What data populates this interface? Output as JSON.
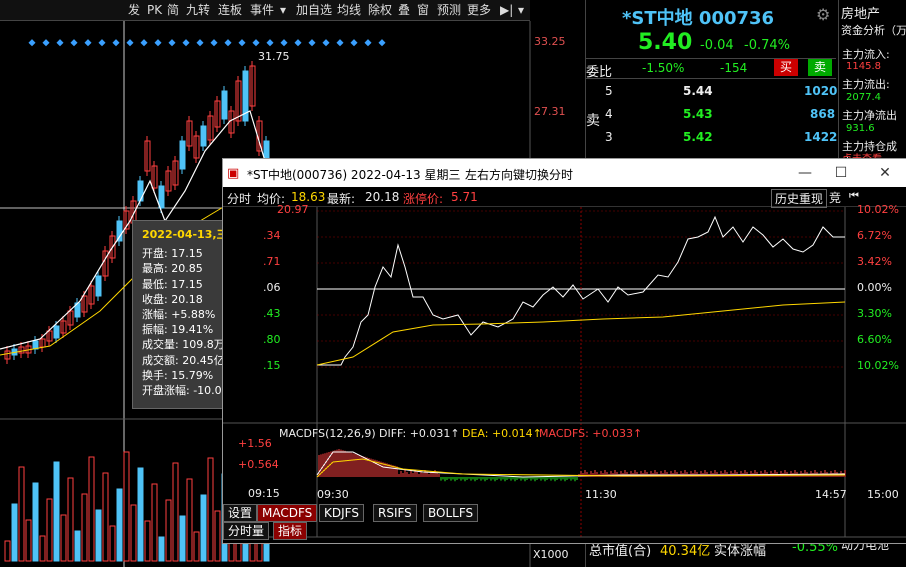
{
  "toolbar": {
    "items": [
      "发",
      "PK",
      "简",
      "九转",
      "连板",
      "事件",
      "▾",
      "加自选",
      "均线",
      "除权",
      "叠",
      "窗",
      "预测",
      "更多",
      "▶|",
      "▾"
    ]
  },
  "main": {
    "price_labels": [
      "33.25",
      "27.31"
    ],
    "peak_label": "31.75",
    "volume_x_label": "X1000",
    "volume_row_labels": [
      "+1.56",
      "+0.564",
      "09:15"
    ]
  },
  "tooltip": {
    "date": "2022-04-13,三",
    "lines": [
      "开盘: 17.15",
      "最高: 20.85",
      "最低: 17.15",
      "收盘: 20.18",
      "涨幅: +5.88%",
      "振幅: 19.41%",
      "成交量: 109.8万",
      "成交额: 20.45亿",
      "换手: 15.79%",
      "开盘涨幅: -10.02%"
    ]
  },
  "stock": {
    "name_code": "*ST中地 000736",
    "price": "5.40",
    "change": "-0.04",
    "change_pct": "-0.74%",
    "weibi_label": "委比",
    "weibi_pct": "-1.50%",
    "weibi_val": "-154",
    "buy_label": "买",
    "sell_label": "卖",
    "sell_side_label": "卖",
    "orders": [
      {
        "level": "5",
        "price": "5.44",
        "vol": "1020"
      },
      {
        "level": "4",
        "price": "5.43",
        "vol": "868"
      },
      {
        "level": "3",
        "price": "5.42",
        "vol": "1422"
      }
    ],
    "sector": "房地产",
    "fund_title": "资金分析（万",
    "fund_lines": [
      {
        "label": "主力流入:",
        "value": "1145.8"
      },
      {
        "label": "主力流出:",
        "value": "2077.4"
      },
      {
        "label": "主力净流出",
        "value": "931.6"
      },
      {
        "label": "主力持仓成本",
        "value": "点击查看"
      }
    ],
    "bottom_left": "总市值(合)",
    "bottom_value": "40.34亿",
    "bottom_mid": "实体涨幅",
    "bottom_pct": "-0.55%",
    "bottom_right": "动力电池"
  },
  "popup": {
    "title": "*ST中地(000736) 2022-04-13 星期三",
    "hint": "左右方向键切换分时",
    "info_label": "分时",
    "avg_label": "均价:",
    "avg_value": "18.63",
    "latest_label": "最新:",
    "latest_value": "20.18",
    "limit_label": "涨停价:",
    "limit_value": "5.71",
    "history_btn": "历史重现",
    "compete_btn": "竞",
    "left_prices": [
      "20.97",
      ".34",
      ".71",
      ".06",
      ".43",
      ".80",
      ".15"
    ],
    "right_pcts": [
      "10.02%",
      "6.72%",
      "3.42%",
      "0.00%",
      "3.30%",
      "6.60%",
      "10.02%"
    ],
    "time_labels": [
      "09:30",
      "11:30",
      "14:57",
      "15:00"
    ],
    "macd_label": "MACDFS(12,26,9)",
    "diff_text": "DIFF: +0.031↑",
    "dea_text": "DEA: +0.014↑",
    "macdfs_text": "MACDFS: +0.033↑",
    "tabs": [
      "设置",
      "MACDFS",
      "KDJFS",
      "RSIFS",
      "BOLLFS"
    ],
    "subtabs": [
      "分时量",
      "指标"
    ]
  },
  "colors": {
    "up": "#ff4040",
    "down": "#22ee22",
    "accent": "#4fc3f7",
    "yellow": "#ffd700"
  },
  "icons": [
    "settings-icon",
    "back-icon"
  ]
}
